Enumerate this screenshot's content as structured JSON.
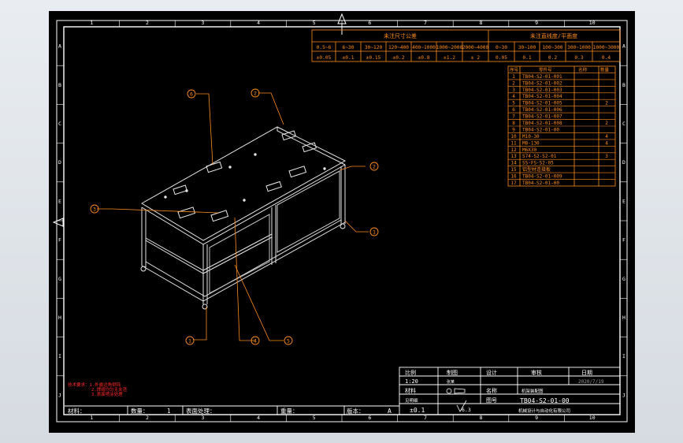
{
  "grid": {
    "cols": [
      "1",
      "2",
      "3",
      "4",
      "5",
      "6",
      "7",
      "8",
      "9",
      "10"
    ],
    "rows": [
      "A",
      "B",
      "C",
      "D",
      "E",
      "F",
      "G",
      "H",
      "I",
      "J"
    ]
  },
  "tolerance_table": {
    "header_left": "未注尺寸公差",
    "header_right": "未注直线度/平面度",
    "left_ranges": [
      "0.5~6",
      "6~30",
      "30~120",
      "120~400",
      "400~1000",
      "1000~2000",
      "2000~4000"
    ],
    "left_values": [
      "±0.05",
      "±0.1",
      "±0.15",
      "±0.2",
      "±0.8",
      "±1.2",
      "± 2"
    ],
    "right_ranges": [
      "0~30",
      "30~100",
      "100~300",
      "300~1000",
      "1000~3000"
    ],
    "right_values": [
      "0.05",
      "0.1",
      "0.2",
      "0.3",
      "0.4"
    ]
  },
  "bom": {
    "headers": [
      "序号",
      "零件号",
      "名称",
      "数量"
    ],
    "rows": [
      {
        "no": "1",
        "part": "TB04-S2-01-001",
        "qty": ""
      },
      {
        "no": "2",
        "part": "TB04-S2-01-002",
        "qty": ""
      },
      {
        "no": "3",
        "part": "TB04-S2-01-003",
        "qty": ""
      },
      {
        "no": "4",
        "part": "TB04-S2-01-004",
        "qty": ""
      },
      {
        "no": "5",
        "part": "TB04-S2-01-005",
        "qty": "2"
      },
      {
        "no": "6",
        "part": "TB04-S2-01-006",
        "qty": ""
      },
      {
        "no": "7",
        "part": "TB04-S2-01-007",
        "qty": ""
      },
      {
        "no": "8",
        "part": "TB04-S2-01-008",
        "qty": "2"
      },
      {
        "no": "9",
        "part": "TB04-S2-01-00",
        "qty": ""
      },
      {
        "no": "10",
        "part": "M10-30",
        "qty": "4"
      },
      {
        "no": "11",
        "part": "M8-130",
        "qty": "4"
      },
      {
        "no": "12",
        "part": "M6X30",
        "qty": ""
      },
      {
        "no": "13",
        "part": "S74-S2-S2-01",
        "qty": "3"
      },
      {
        "no": "14",
        "part": "SS-FS-S2-05",
        "qty": ""
      },
      {
        "no": "15",
        "part": "铝型材连接板",
        "qty": ""
      },
      {
        "no": "16",
        "part": "TB04-S2-01-009",
        "qty": ""
      },
      {
        "no": "17",
        "part": "TB04-S2-01-00",
        "qty": ""
      }
    ]
  },
  "balloons": [
    "1",
    "2",
    "3",
    "4",
    "5",
    "6"
  ],
  "notes": [
    "技术要求：1.外露边角倒钝",
    "2.焊缝均匀无夹渣",
    "3.表面喷涂处理"
  ],
  "title_block": {
    "labels": [
      "比例",
      "制图",
      "设计",
      "审核",
      "日期"
    ],
    "scale": "1:20",
    "draw_name": "张某",
    "date": "2020/7/19",
    "material_label": "材料",
    "material_value": "见明细",
    "name_label": "名称",
    "name_value": "机架装配图",
    "drawing_no_label": "图号",
    "drawing_no": "TB04-S2-01-00",
    "company": "机械设计与自动化有限公司",
    "tolerance_value": "±0.1",
    "roughness": "6.3",
    "bottom_material": "材料：",
    "bottom_qty": "数量：",
    "bottom_qty_value": "1",
    "bottom_surface": "表面处理：",
    "bottom_weight": "重量：",
    "bottom_version": "版本：",
    "bottom_version_value": "A"
  }
}
